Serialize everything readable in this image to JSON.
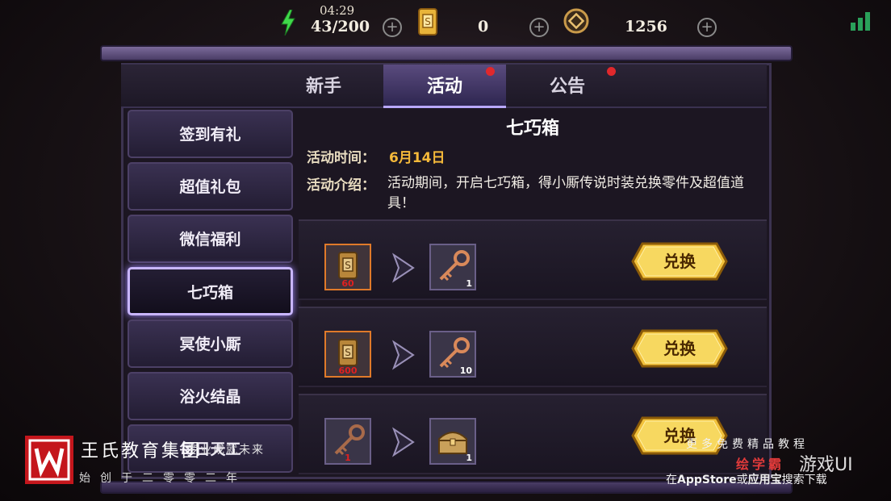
{
  "hud": {
    "time": "04:29",
    "energy": "43/200",
    "tickets": "0",
    "coins": "1256",
    "plus": "+",
    "icons": [
      "lightning-icon",
      "ticket-icon",
      "coin-icon",
      "signal-icon"
    ]
  },
  "tabs": [
    {
      "label": "新手"
    },
    {
      "label": "活动",
      "active": true,
      "badge": true
    },
    {
      "label": "公告",
      "badge": true
    }
  ],
  "sidebar": {
    "items": [
      {
        "label": "签到有礼"
      },
      {
        "label": "超值礼包"
      },
      {
        "label": "微信福利"
      },
      {
        "label": "七巧箱",
        "active": true
      },
      {
        "label": "冥使小厮"
      },
      {
        "label": "浴火结晶"
      },
      {
        "label": "每日天工"
      }
    ]
  },
  "content": {
    "title": "七巧箱",
    "time_label": "活动时间：",
    "time_value": "6月14日",
    "desc_label": "活动介绍：",
    "desc_value": "活动期间，开启七巧箱，得小厮传说时装兑换零件及超值道具！",
    "rows": [
      {
        "cost_item": "ticket-icon",
        "cost": "60",
        "reward_item": "key-icon",
        "reward": "1",
        "button": "兑换"
      },
      {
        "cost_item": "ticket-icon",
        "cost": "600",
        "reward_item": "key-icon",
        "reward": "10",
        "button": "兑换"
      },
      {
        "cost_item": "key-icon",
        "cost": "1",
        "reward_item": "chest-icon",
        "reward": "1",
        "button": "兑换"
      }
    ]
  },
  "watermark": {
    "left_name": "王氏教育集团",
    "left_slogan": "专业成就未来",
    "left_since": "始创于二零零二年",
    "right_line1": "更多免费精品教程",
    "right_line2a": "绘学霸",
    "right_line2b": "游戏UI",
    "right_line3_pre": "在",
    "right_line3_store": "AppStore",
    "right_line3_mid": "或",
    "right_line3_app": "应用宝",
    "right_line3_post": "搜索下载"
  },
  "colors": {
    "accent": "#b9a8ff",
    "gold": "#f5b93a",
    "badge": "#e0282c"
  }
}
